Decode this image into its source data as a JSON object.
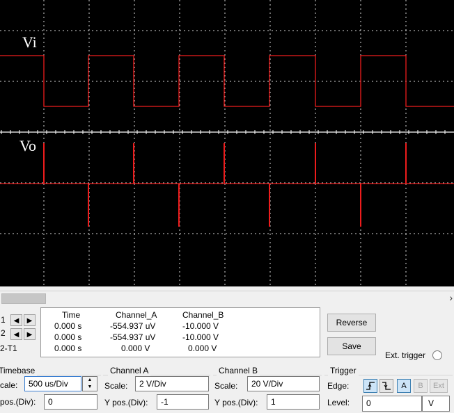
{
  "screen": {
    "background": "#000000",
    "grid_color": "#ffffff",
    "trace_color": "#ee1c1c",
    "channel_a_label": "Vi",
    "channel_b_label": "Vo",
    "divisions_x": 10,
    "divisions_y": 8
  },
  "cursors": {
    "t1_label": "1",
    "t2_label": "2",
    "diff_label": "2-T1"
  },
  "readout": {
    "headers": {
      "time": "Time",
      "channel_a": "Channel_A",
      "channel_b": "Channel_B"
    },
    "rows": [
      {
        "time": "0.000 s",
        "channel_a": "-554.937 uV",
        "channel_b": "-10.000 V"
      },
      {
        "time": "0.000 s",
        "channel_a": "-554.937 uV",
        "channel_b": "-10.000 V"
      },
      {
        "time": "0.000 s",
        "channel_a": "0.000 V",
        "channel_b": "0.000 V"
      }
    ]
  },
  "buttons": {
    "reverse": "Reverse",
    "save": "Save",
    "ext_trigger": "Ext. trigger"
  },
  "timebase": {
    "title": "Timebase",
    "scale_label": "cale:",
    "scale_value": "500 us/Div",
    "xpos_label": "pos.(Div):",
    "xpos_value": "0"
  },
  "channel_a": {
    "title": "Channel A",
    "scale_label": "Scale:",
    "scale_value": "2  V/Div",
    "ypos_label": "Y pos.(Div):",
    "ypos_value": "-1"
  },
  "channel_b": {
    "title": "Channel B",
    "scale_label": "Scale:",
    "scale_value": "20  V/Div",
    "ypos_label": "Y pos.(Div):",
    "ypos_value": "1"
  },
  "trigger": {
    "title": "Trigger",
    "edge_label": "Edge:",
    "rising_icon": "rising-edge-icon",
    "falling_icon": "falling-edge-icon",
    "source_a": "A",
    "source_b": "B",
    "source_ext": "Ext",
    "level_label": "Level:",
    "level_value": "0",
    "level_unit": "V"
  },
  "chart_data": {
    "type": "line",
    "series": [
      {
        "name": "Vi",
        "color": "#ee1c1c",
        "x": [
          0,
          63,
          63,
          127,
          127,
          192,
          192,
          257,
          257,
          322,
          322,
          387,
          387,
          453,
          453,
          518,
          518,
          583,
          583,
          652
        ],
        "y": [
          1,
          1,
          -1,
          -1,
          1,
          1,
          -1,
          -1,
          1,
          1,
          -1,
          -1,
          1,
          1,
          -1,
          -1,
          1,
          1,
          -1,
          -1
        ]
      },
      {
        "name": "Vo",
        "color": "#ee1c1c",
        "spikes_x": [
          63,
          127,
          192,
          257,
          322,
          387,
          453,
          518,
          583
        ],
        "spikes_dir": [
          1,
          -1,
          1,
          -1,
          1,
          -1,
          1,
          -1,
          1
        ]
      }
    ]
  }
}
